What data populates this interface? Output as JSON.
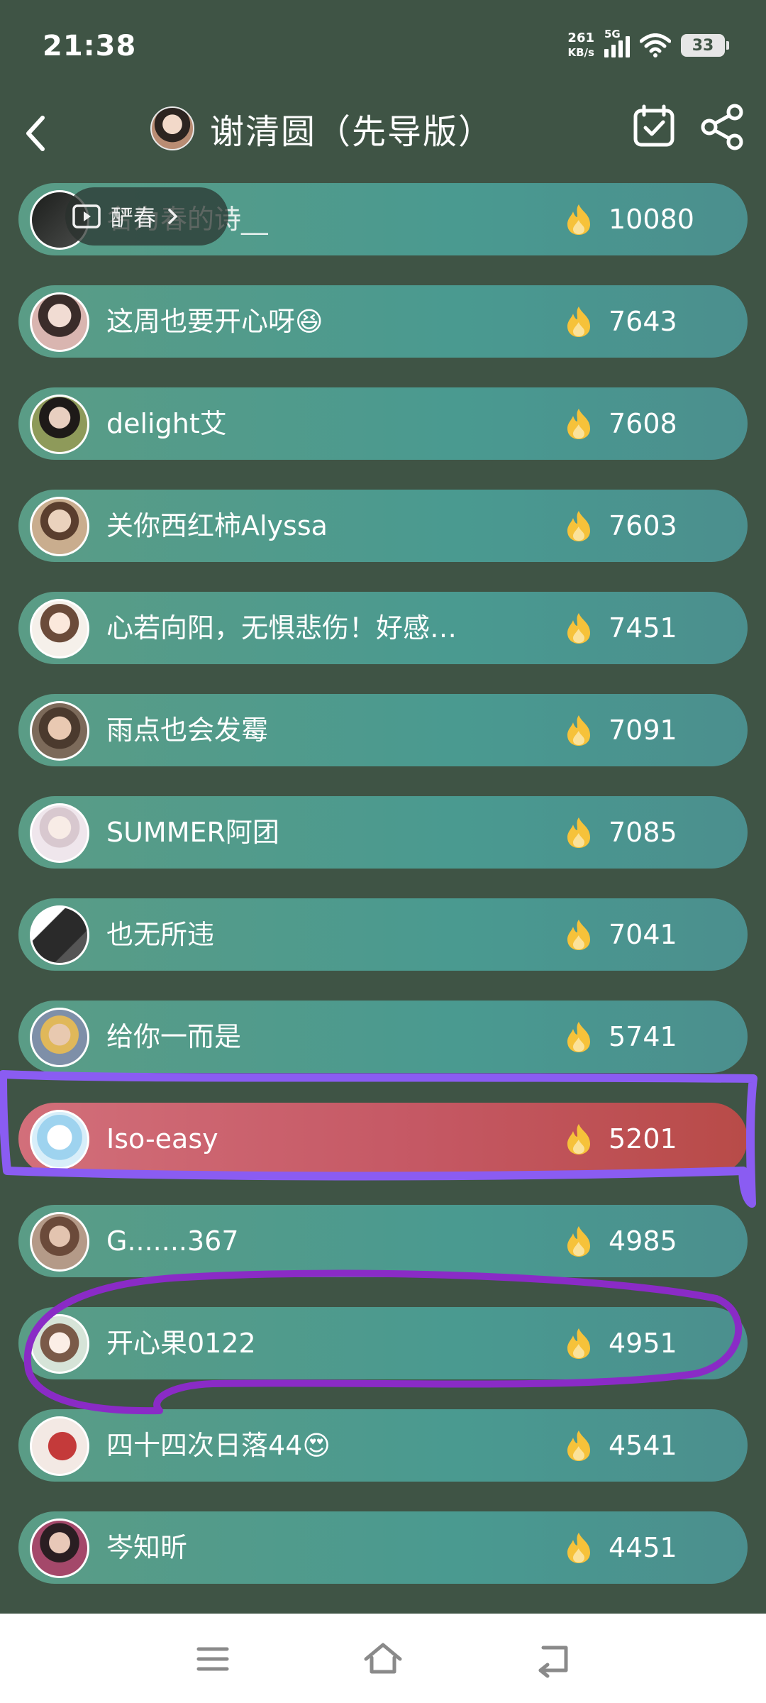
{
  "status": {
    "time": "21:38",
    "net_speed_value": "261",
    "net_speed_unit": "KB/s",
    "network": "5G",
    "battery": "33"
  },
  "header": {
    "title": "谢清圆（先导版）",
    "back_icon": "back-arrow-icon",
    "calendar_icon": "calendar-check-icon",
    "share_icon": "share-icon"
  },
  "video_chip": {
    "label": "酽春"
  },
  "ranking": [
    {
      "name": "名为春的诗__",
      "score": "10080",
      "avatar_color": "#2b2d2b"
    },
    {
      "name": "这周也要开心呀😆",
      "score": "7643",
      "avatar_color": "#d8b9b5"
    },
    {
      "name": "delight艾",
      "score": "7608",
      "avatar_color": "#6f7a4b"
    },
    {
      "name": "关你西红柿Alyssa",
      "score": "7603",
      "avatar_color": "#c9ad8e"
    },
    {
      "name": "心若向阳，无惧悲伤！好感爱…",
      "score": "7451",
      "avatar_color": "#f3ede7"
    },
    {
      "name": "雨点也会发霉",
      "score": "7091",
      "avatar_color": "#6e5b4b"
    },
    {
      "name": "SUMMER阿团",
      "score": "7085",
      "avatar_color": "#e9dfe6"
    },
    {
      "name": "也无所违",
      "score": "7041",
      "avatar_color": "#2a2a2a"
    },
    {
      "name": "给你一而是",
      "score": "5741",
      "avatar_color": "#b9a58f"
    },
    {
      "name": "Iso-easy",
      "score": "5201",
      "avatar_color": "#bfe3f5",
      "highlight": true
    },
    {
      "name": "G.......367",
      "score": "4985",
      "avatar_color": "#a88c7a"
    },
    {
      "name": "开心果0122",
      "score": "4951",
      "avatar_color": "#d6e4d8"
    },
    {
      "name": "四十四次日落44😍",
      "score": "4541",
      "avatar_color": "#c43a3a"
    },
    {
      "name": "岑知昕",
      "score": "4451",
      "avatar_color": "#8a4a6a"
    }
  ],
  "colors": {
    "background": "#3f5445",
    "row": "#4e9a8a",
    "highlight_row": "#c55864",
    "annotation_blue": "#8a5cf2",
    "annotation_purple": "#8a2bc6",
    "fire": "#f6c23a"
  },
  "nav": {
    "menu_icon": "menu-icon",
    "home_icon": "home-icon",
    "back_icon": "nav-back-icon"
  }
}
